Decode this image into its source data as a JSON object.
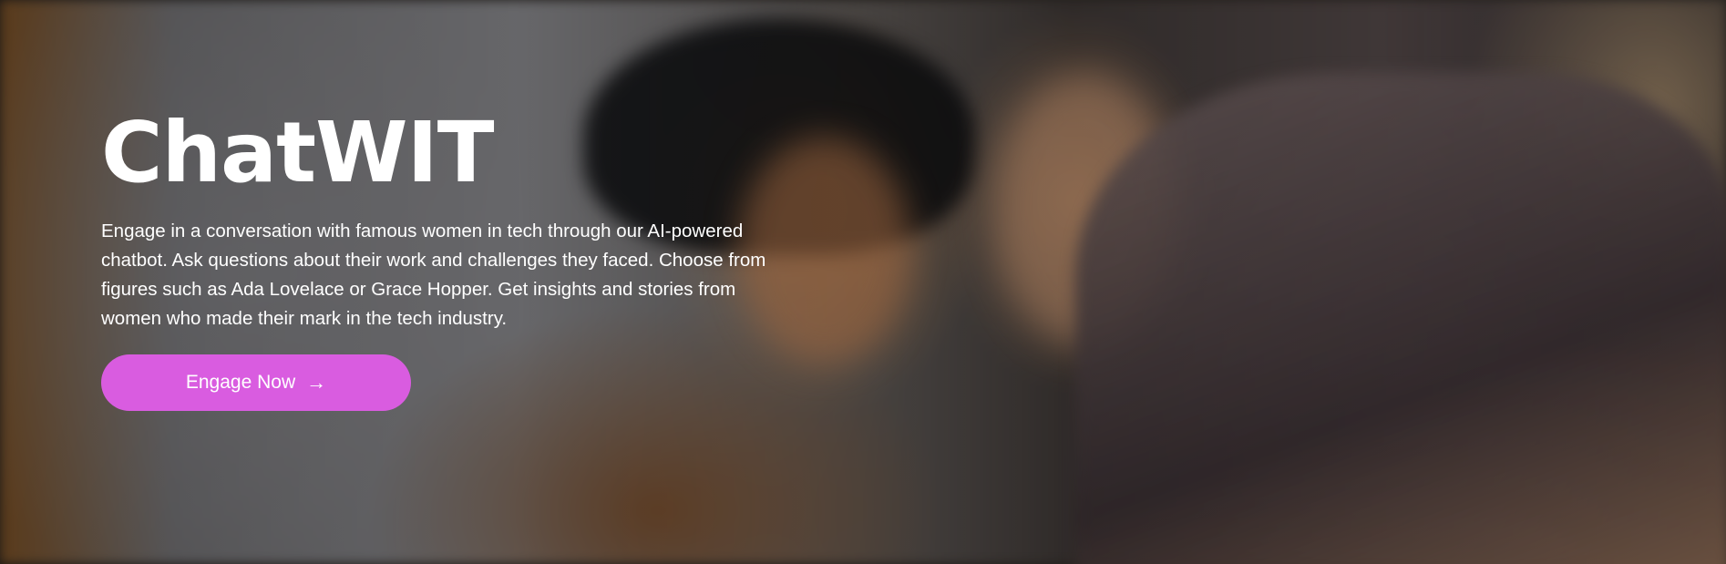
{
  "hero": {
    "title": "ChatWIT",
    "description": "Engage in a conversation with famous women in tech through our AI-powered chatbot. Ask questions about their work and challenges they faced. Choose from figures such as Ada Lovelace or Grace Hopper. Get insights and stories from women who made their mark in the tech industry.",
    "cta_label": "Engage Now",
    "cta_icon": "arrow-right-icon",
    "cta_color": "#d95ce0",
    "background_image": "photo of three women laughing together"
  }
}
